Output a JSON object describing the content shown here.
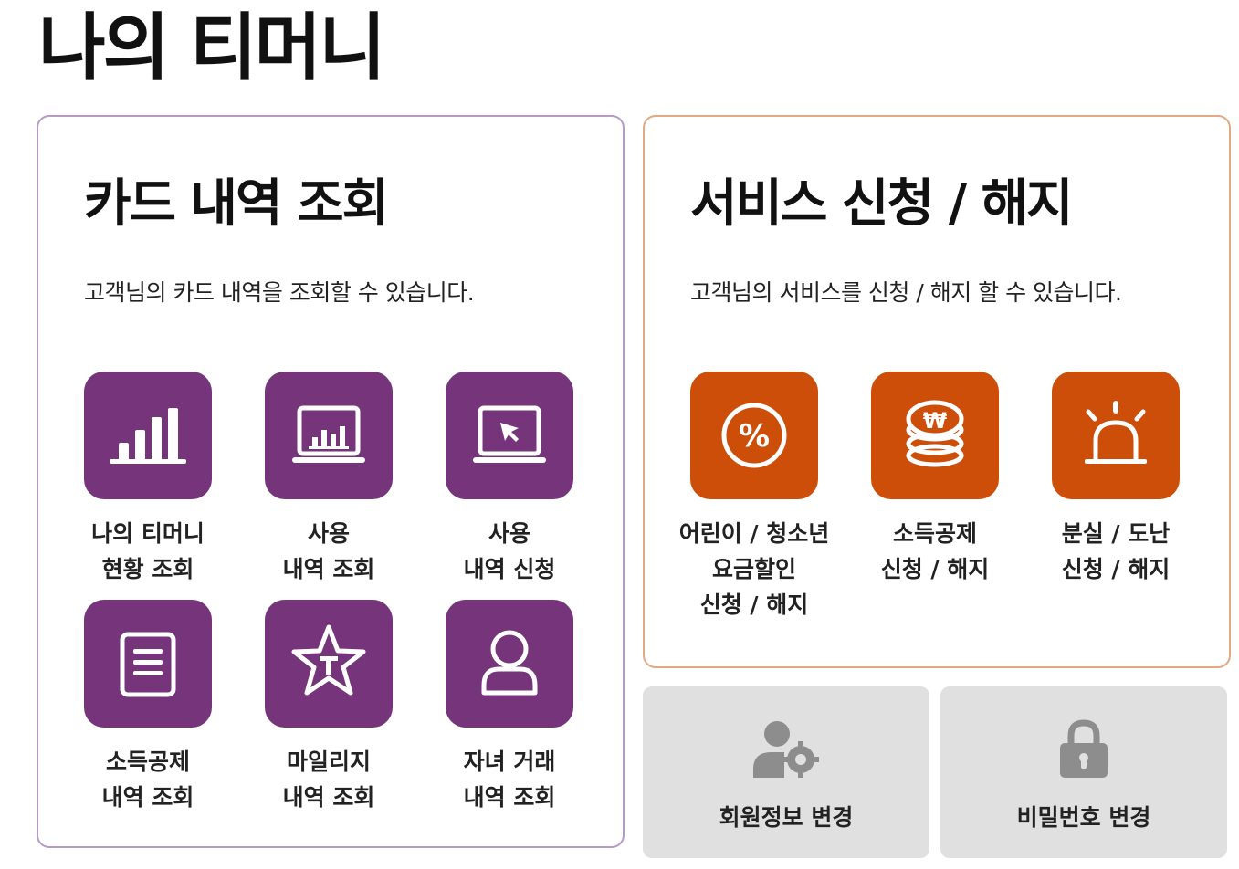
{
  "page": {
    "title": "나의 티머니"
  },
  "card_panel": {
    "title": "카드 내역 조회",
    "description": "고객님의 카드 내역을 조회할 수 있습니다.",
    "items": [
      {
        "icon": "bar-chart-icon",
        "lines": [
          "나의 티머니",
          "현황 조회"
        ]
      },
      {
        "icon": "laptop-chart-icon",
        "lines": [
          "사용",
          "내역 조회"
        ]
      },
      {
        "icon": "laptop-cursor-icon",
        "lines": [
          "사용",
          "내역 신청"
        ]
      },
      {
        "icon": "document-icon",
        "lines": [
          "소득공제",
          "내역 조회"
        ]
      },
      {
        "icon": "star-icon",
        "lines": [
          "마일리지",
          "내역 조회"
        ]
      },
      {
        "icon": "user-icon",
        "lines": [
          "자녀 거래",
          "내역 조회"
        ]
      }
    ]
  },
  "service_panel": {
    "title": "서비스 신청 / 해지",
    "description": "고객님의 서비스를 신청 / 해지 할 수 있습니다.",
    "items": [
      {
        "icon": "percent-icon",
        "lines": [
          "어린이 / 청소년",
          "요금할인",
          "신청 / 해지"
        ]
      },
      {
        "icon": "coin-stack-icon",
        "lines": [
          "소득공제",
          "신청 / 해지"
        ]
      },
      {
        "icon": "siren-icon",
        "lines": [
          "분실 / 도난",
          "신청 / 해지"
        ]
      }
    ]
  },
  "bottom_buttons": {
    "member_info": {
      "label": "회원정보 변경",
      "icon": "user-gear-icon"
    },
    "password": {
      "label": "비밀번호 변경",
      "icon": "lock-icon"
    }
  },
  "colors": {
    "purple": "#76347b",
    "orange": "#cc4e08",
    "card_border": "#b79ac6",
    "service_border": "#e3a986",
    "gray_button": "#e0e0e0",
    "gray_icon": "#8d8d8d"
  }
}
